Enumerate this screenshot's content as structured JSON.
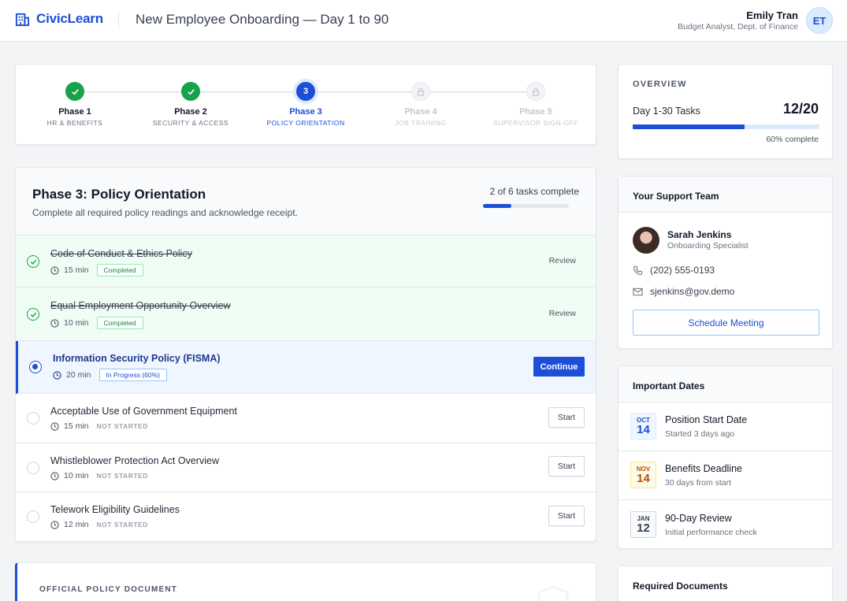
{
  "header": {
    "brand": "CivicLearn",
    "title": "New Employee Onboarding — Day 1 to 90",
    "user_name": "Emily Tran",
    "user_role": "Budget Analyst, Dept. of Finance",
    "user_initials": "ET"
  },
  "stepper": {
    "steps": [
      {
        "title": "Phase 1",
        "sub": "HR & BENEFITS",
        "state": "done"
      },
      {
        "title": "Phase 2",
        "sub": "SECURITY & ACCESS",
        "state": "done"
      },
      {
        "title": "Phase 3",
        "sub": "POLICY ORIENTATION",
        "state": "current",
        "number": "3"
      },
      {
        "title": "Phase 4",
        "sub": "JOB TRAINING",
        "state": "locked"
      },
      {
        "title": "Phase 5",
        "sub": "SUPERVISOR SIGN-OFF",
        "state": "locked"
      }
    ]
  },
  "phase": {
    "title": "Phase 3: Policy Orientation",
    "description": "Complete all required policy readings and acknowledge receipt.",
    "count_text": "2 of 6 tasks complete",
    "progress": 0.333,
    "tasks": [
      {
        "title": "Code of Conduct & Ethics Policy",
        "duration": "15 min",
        "status": "Completed",
        "action": "Review"
      },
      {
        "title": "Equal Employment Opportunity Overview",
        "duration": "10 min",
        "status": "Completed",
        "action": "Review"
      },
      {
        "title": "Information Security Policy (FISMA)",
        "duration": "20 min",
        "status": "In Progress (60%)",
        "action": "Continue"
      },
      {
        "title": "Acceptable Use of Government Equipment",
        "duration": "15 min",
        "status": "NOT STARTED",
        "action": "Start"
      },
      {
        "title": "Whistleblower Protection Act Overview",
        "duration": "10 min",
        "status": "NOT STARTED",
        "action": "Start"
      },
      {
        "title": "Telework Eligibility Guidelines",
        "duration": "12 min",
        "status": "NOT STARTED",
        "action": "Start"
      }
    ]
  },
  "document": {
    "label": "OFFICIAL POLICY DOCUMENT"
  },
  "overview": {
    "label": "OVERVIEW",
    "task_label": "Day 1-30 Tasks",
    "count": "12/20",
    "progress": 0.6,
    "percent_text": "60% complete"
  },
  "support": {
    "title": "Your Support Team",
    "name": "Sarah Jenkins",
    "role": "Onboarding Specialist",
    "phone": "(202) 555-0193",
    "email": "sjenkins@gov.demo",
    "button": "Schedule Meeting"
  },
  "dates": {
    "title": "Important Dates",
    "items": [
      {
        "month": "OCT",
        "day": "14",
        "title": "Position Start Date",
        "sub": "Started 3 days ago",
        "tone": "blue"
      },
      {
        "month": "NOV",
        "day": "14",
        "title": "Benefits Deadline",
        "sub": "30 days from start",
        "tone": "amber"
      },
      {
        "month": "JAN",
        "day": "12",
        "title": "90-Day Review",
        "sub": "Initial performance check",
        "tone": "gray"
      }
    ]
  },
  "required_docs": {
    "title": "Required Documents"
  },
  "colors": {
    "accent": "#1d4ed8",
    "success": "#16a34a",
    "warning": "#b45309"
  }
}
